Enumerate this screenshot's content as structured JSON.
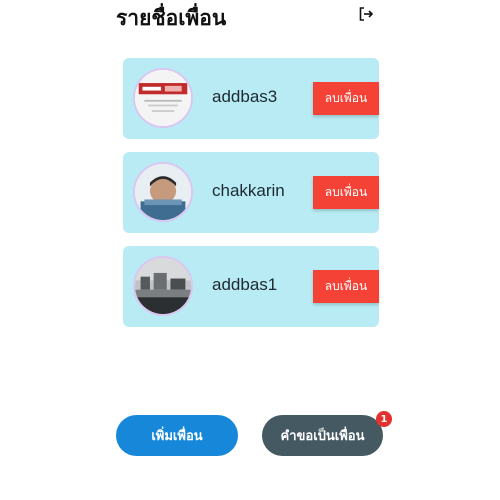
{
  "header": {
    "title": "รายชื่อเพื่อน",
    "logout_icon": "logout-icon"
  },
  "friends": [
    {
      "name": "addbas3",
      "remove_label": "ลบเพื่อน"
    },
    {
      "name": "chakkarin",
      "remove_label": "ลบเพื่อน"
    },
    {
      "name": "addbas1",
      "remove_label": "ลบเพื่อน"
    }
  ],
  "footer": {
    "add_friend_label": "เพิ่มเพื่อน",
    "requests_label": "คำขอเป็นเพื่อน",
    "requests_badge": "1"
  },
  "colors": {
    "card_bg": "#b8ebf4",
    "remove_button": "#f44336",
    "add_button": "#1687d9",
    "requests_button": "#455963",
    "badge": "#e5312f"
  }
}
